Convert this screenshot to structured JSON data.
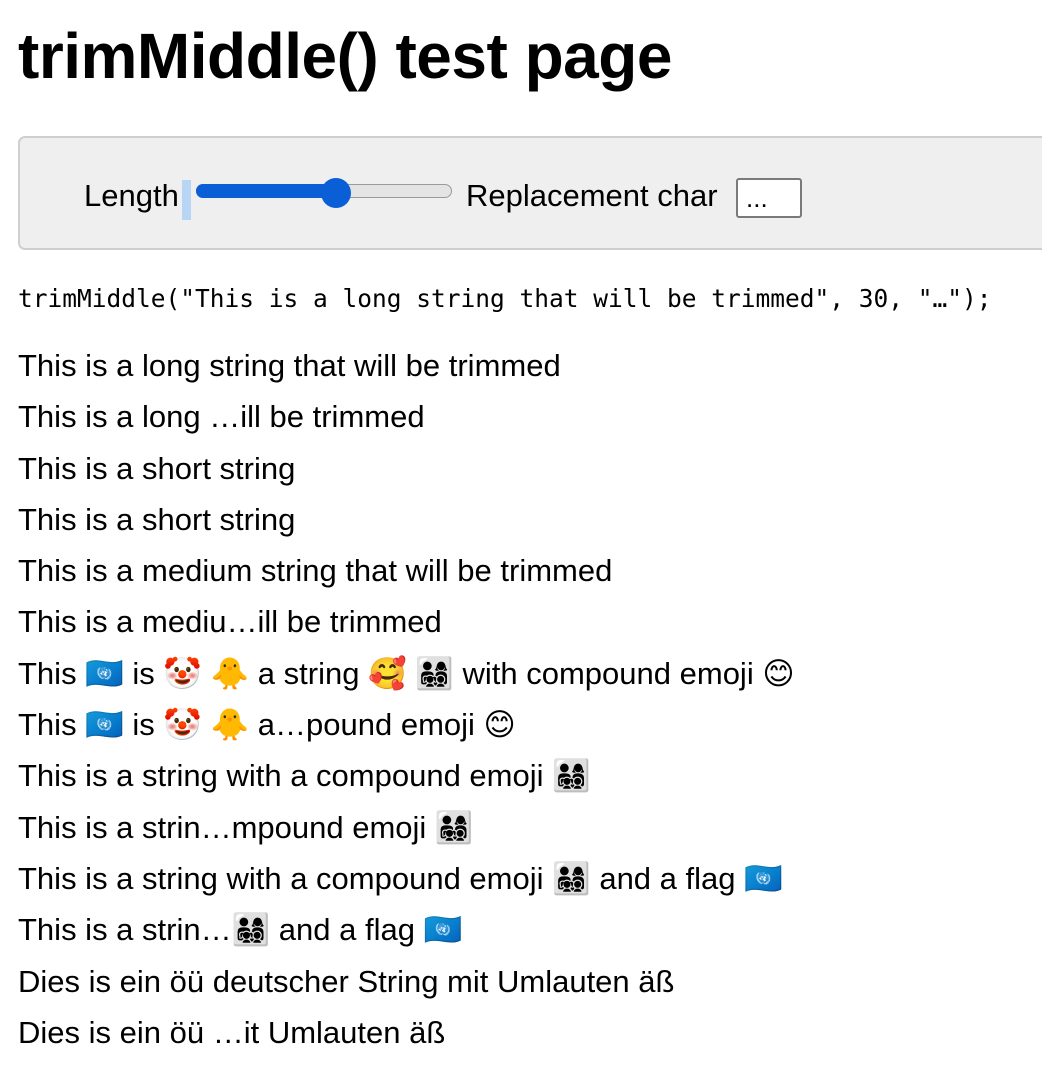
{
  "page": {
    "title": "trimMiddle() test page"
  },
  "controls": {
    "length_label": "Length",
    "length_value": 30,
    "length_min": 0,
    "length_max": 55,
    "replacement_label": "Replacement char",
    "replacement_value": "..."
  },
  "code_line": "trimMiddle(\"This is a long string that will be trimmed\", 30, \"…\");",
  "lines": [
    "This is a long string that will be trimmed",
    "This is a long …ill be trimmed",
    "This is a short string",
    "This is a short string",
    "This is a medium string that will be trimmed",
    "This is a mediu…ill be trimmed",
    "This 🇺🇳 is 🤡 🐥 a string 🥰 👨‍👩‍👧‍👦 with compound emoji 😊",
    "This 🇺🇳 is 🤡 🐥 a…pound emoji 😊",
    "This is a string with a compound emoji 👨‍👩‍👧‍👦",
    "This is a strin…mpound emoji 👨‍👩‍👧‍👦",
    "This is a string with a compound emoji 👨‍👩‍👧‍👦 and a flag 🇺🇳",
    "This is a strin…👨‍👩‍👧‍👦 and a flag 🇺🇳",
    "Dies is ein öü deutscher String mit Umlauten äß",
    "Dies is ein öü …it Umlauten äß"
  ],
  "colors": {
    "accent": "#0b5fd6",
    "panel_background": "#efefef",
    "panel_border": "#cfcfcf",
    "focus_highlight": "#b9d5f5"
  }
}
